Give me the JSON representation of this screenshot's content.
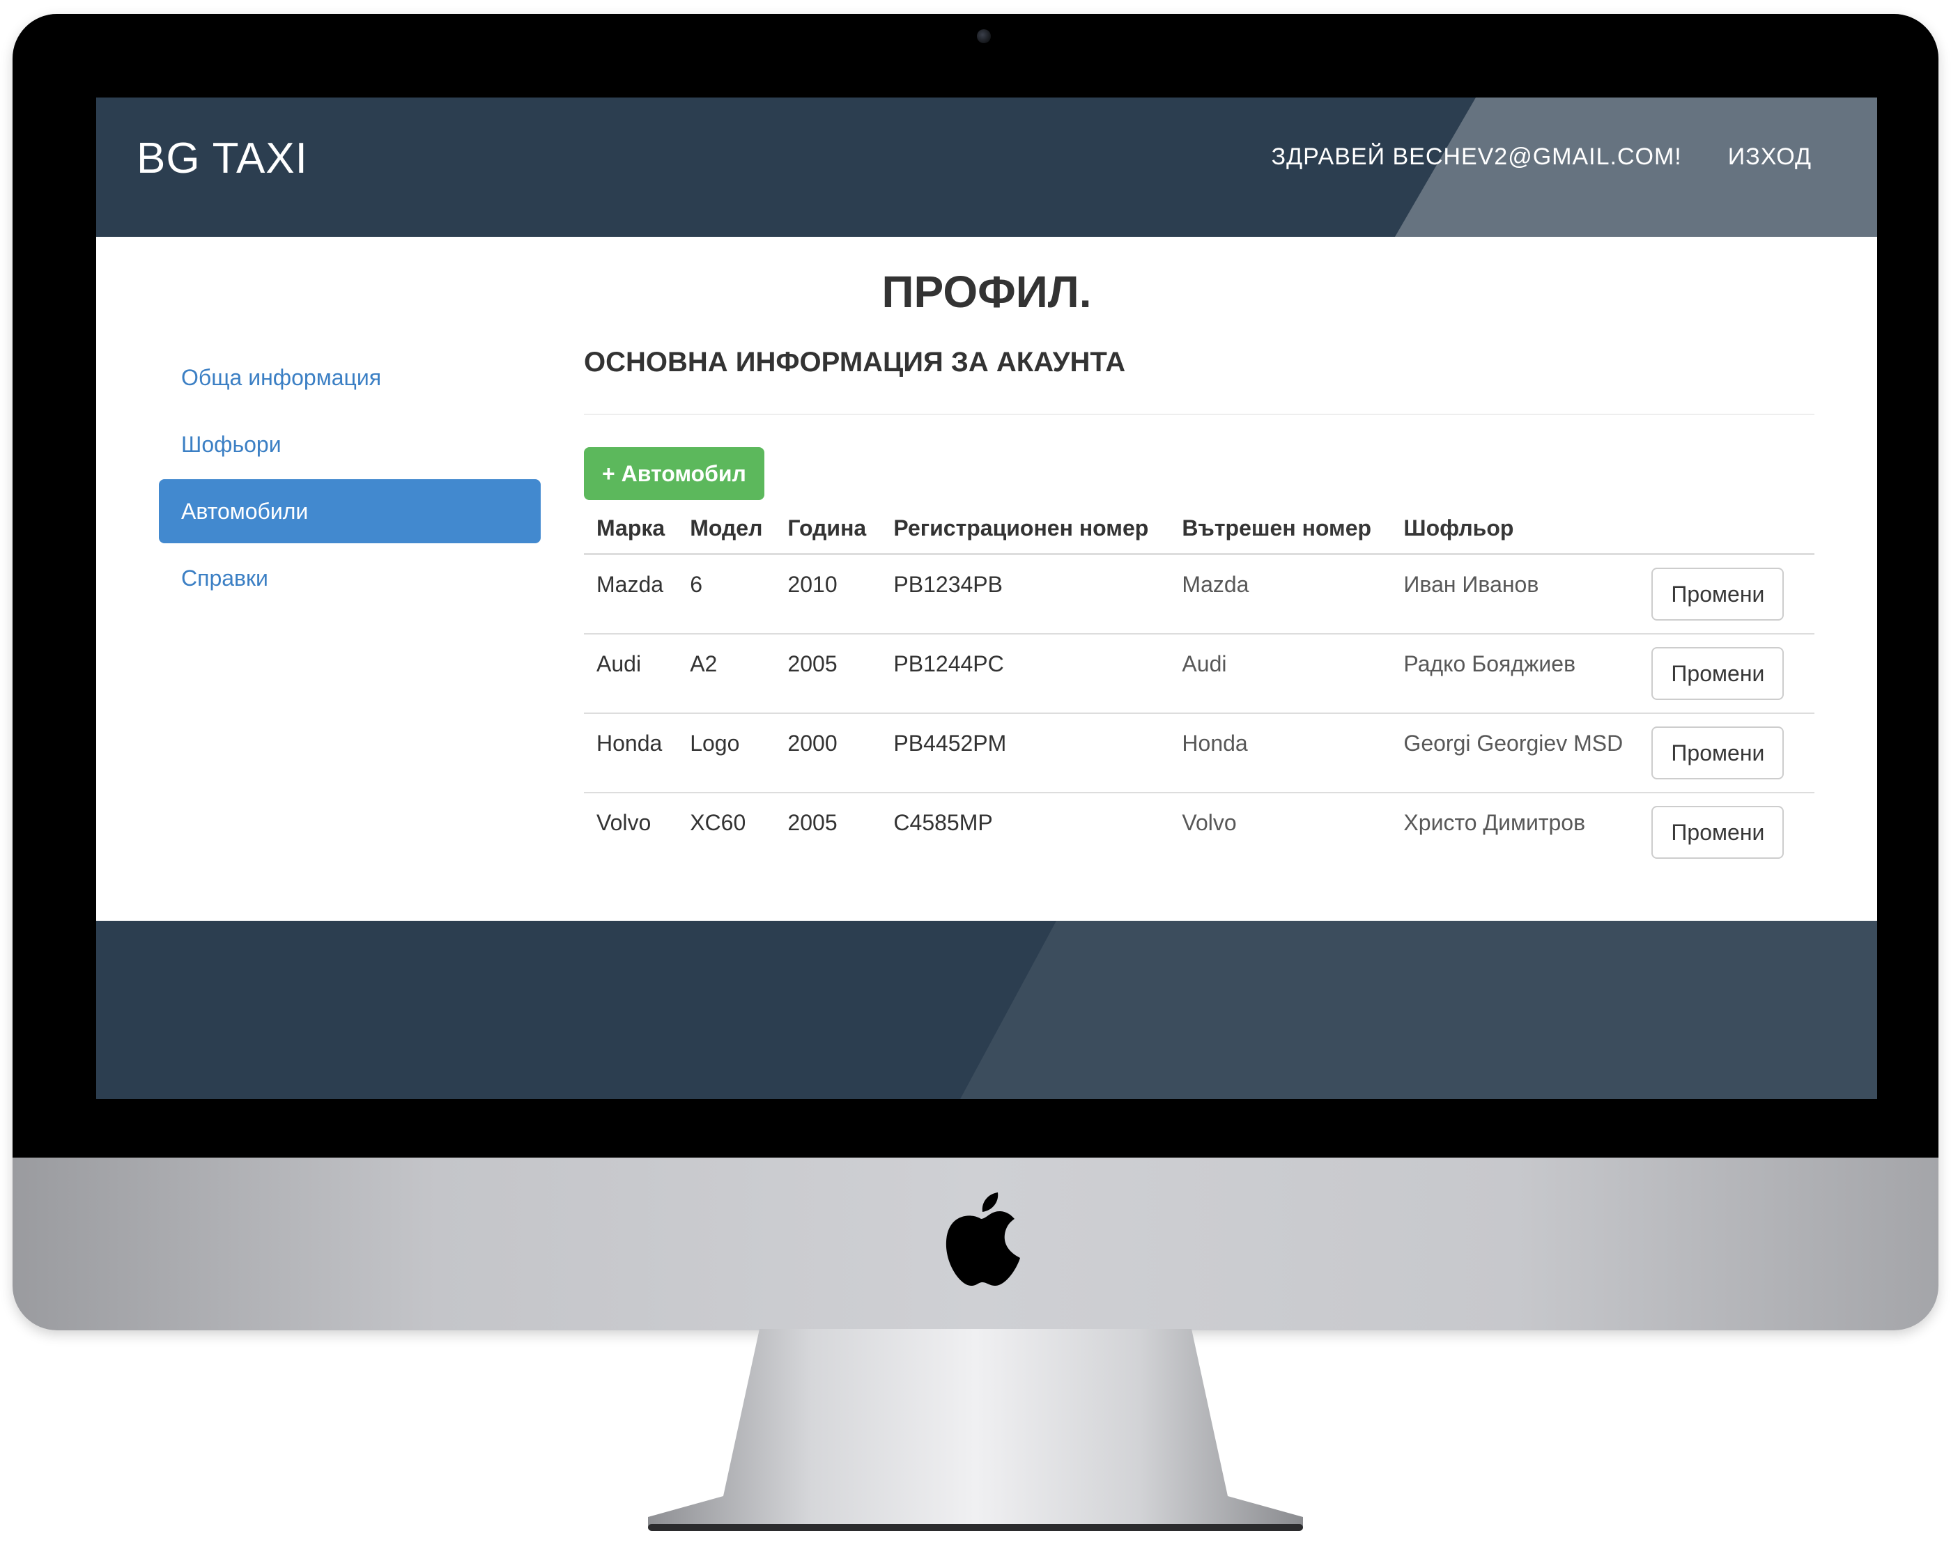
{
  "app": {
    "brand": "BG TAXI"
  },
  "nav": {
    "greeting": "ЗДРАВЕЙ BECHEV2@GMAIL.COM!",
    "logout": "ИЗХОД"
  },
  "page": {
    "title": "ПРОФИЛ.",
    "section_title": "ОСНОВНА ИНФОРМАЦИЯ ЗА АКАУНТА"
  },
  "sidebar": {
    "items": [
      {
        "label": "Обща информация",
        "active": false
      },
      {
        "label": "Шофьори",
        "active": false
      },
      {
        "label": "Автомобили",
        "active": true
      },
      {
        "label": "Справки",
        "active": false
      }
    ]
  },
  "toolbar": {
    "add_label": "+ Автомобил"
  },
  "table": {
    "headers": [
      "Марка",
      "Модел",
      "Година",
      "Регистрационен номер",
      "Вътрешен номер",
      "Шофльор"
    ],
    "edit_label": "Промени",
    "rows": [
      [
        "Mazda",
        "6",
        "2010",
        "PB1234PB",
        "Mazda",
        "Иван Иванов"
      ],
      [
        "Audi",
        "A2",
        "2005",
        "PB1244PC",
        "Audi",
        "Радко Бояджиев"
      ],
      [
        "Honda",
        "Logo",
        "2000",
        "PB4452PM",
        "Honda",
        "Georgi Georgiev MSD"
      ],
      [
        "Volvo",
        "XC60",
        "2005",
        "C4585MP",
        "Volvo",
        "Христо Димитров"
      ]
    ]
  },
  "colors": {
    "navbar": "#2c3e50",
    "accent": "#4289cf",
    "link": "#3b7fc4",
    "success": "#5cb85c"
  },
  "icons": {
    "device_logo": "apple-logo-icon",
    "camera": "camera-icon"
  }
}
